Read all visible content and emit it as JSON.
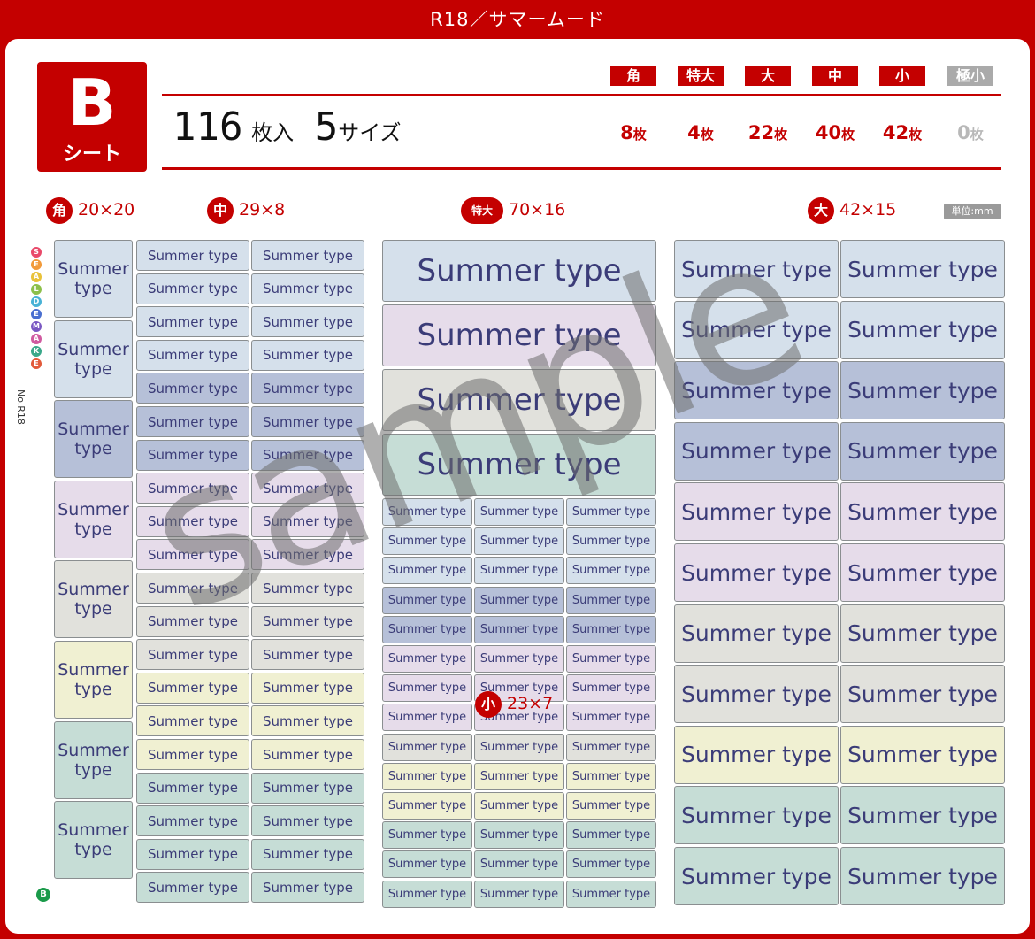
{
  "title": "R18／サマームード",
  "sheet": {
    "letter": "B",
    "label": "シート"
  },
  "summary": {
    "count": "116",
    "count_unit": "枚入",
    "sizes": "5",
    "sizes_unit": "サイズ"
  },
  "sizes": [
    {
      "name": "角",
      "count": "8",
      "unit": "枚",
      "active": true
    },
    {
      "name": "特大",
      "count": "4",
      "unit": "枚",
      "active": true
    },
    {
      "name": "大",
      "count": "22",
      "unit": "枚",
      "active": true
    },
    {
      "name": "中",
      "count": "40",
      "unit": "枚",
      "active": true
    },
    {
      "name": "小",
      "count": "42",
      "unit": "枚",
      "active": true
    },
    {
      "name": "極小",
      "count": "0",
      "unit": "枚",
      "active": false
    }
  ],
  "section_headers": {
    "kaku": {
      "tag": "角",
      "dims": "20×20"
    },
    "chu": {
      "tag": "中",
      "dims": "29×8"
    },
    "tokudai": {
      "tag": "特大",
      "dims": "70×16"
    },
    "dai": {
      "tag": "大",
      "dims": "42×15"
    },
    "sho": {
      "tag": "小",
      "dims": "23×7"
    }
  },
  "unit_label": "単位:mm",
  "label_text": "Summer type",
  "label_text_kaku": "Summer type",
  "logo_letters": [
    "S",
    "E",
    "A",
    "L",
    "D",
    "E",
    "M",
    "A",
    "K",
    "E"
  ],
  "logo_no": "No.R18",
  "footer_mark": "B",
  "watermark": "sample",
  "colors": {
    "red": "#c40000",
    "blue": "#d5e0eb",
    "navy": "#b6c0d8",
    "pink": "#e6dcea",
    "gray": "#e1e1dc",
    "yellow": "#f0f0d2",
    "green": "#c6ddd6",
    "text": "#3b3c78"
  }
}
